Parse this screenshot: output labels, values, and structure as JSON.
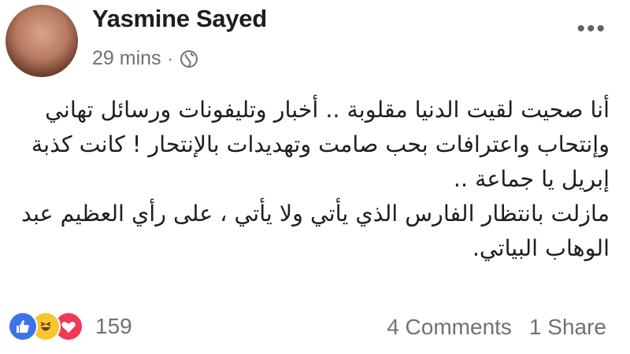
{
  "post": {
    "author": "Yasmine Sayed",
    "time": "29 mins",
    "separator": "·",
    "privacy_icon": "globe-icon",
    "more_icon": "more-options-icon",
    "text_lines": [
      "أنا صحيت لقيت الدنيا مقلوبة .. أخبار وتليفونات ورسائل تهاني",
      "وإنتحاب واعترافات بحب صامت وتهديدات بالإنتحار ! كانت كذبة",
      "إبريل يا جماعة ..",
      "مازلت بانتظار الفارس الذي يأتي ولا يأتي ، على رأي العظيم عبد",
      "الوهاب البياتي."
    ]
  },
  "footer": {
    "reactions": [
      "like-icon",
      "haha-icon",
      "love-icon"
    ],
    "reaction_count": "159",
    "comments": "4 Comments",
    "shares": "1 Share"
  },
  "colors": {
    "like": "#3b74e6",
    "haha": "#f7c532",
    "love": "#ef3a55",
    "muted_text": "#6d7178"
  }
}
